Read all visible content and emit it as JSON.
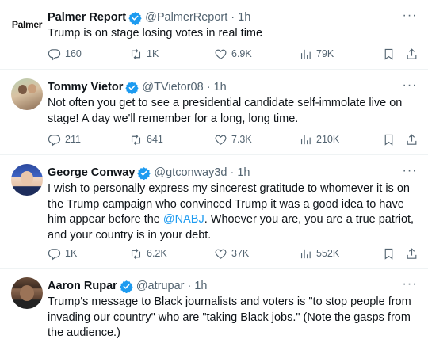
{
  "tweets": [
    {
      "name": "Palmer Report",
      "handle": "@PalmerReport",
      "sep": "·",
      "time": "1h",
      "avatar_text": "Palmer",
      "text_parts": [
        "Trump is on stage losing votes in real time"
      ],
      "mention": "",
      "text_after": "",
      "stats": {
        "replies": "160",
        "reposts": "1K",
        "likes": "6.9K",
        "views": "79K"
      }
    },
    {
      "name": "Tommy Vietor",
      "handle": "@TVietor08",
      "sep": "·",
      "time": "1h",
      "text_parts": [
        "Not often you get to see a presidential candidate self-immolate live on stage! A day we'll remember for a long, long time."
      ],
      "mention": "",
      "text_after": "",
      "stats": {
        "replies": "211",
        "reposts": "641",
        "likes": "7.3K",
        "views": "210K"
      }
    },
    {
      "name": "George Conway",
      "handle": "@gtconway3d",
      "sep": "·",
      "time": "1h",
      "text_parts": [
        "I wish to personally express my sincerest gratitude to whomever it is on the Trump campaign who convinced Trump it was a good idea to have him appear before the "
      ],
      "mention": "@NABJ",
      "text_after": ".  Whoever you are, you are a true patriot, and your country is in your debt.",
      "stats": {
        "replies": "1K",
        "reposts": "6.2K",
        "likes": "37K",
        "views": "552K"
      }
    },
    {
      "name": "Aaron Rupar",
      "handle": "@atrupar",
      "sep": "·",
      "time": "1h",
      "text_parts": [
        "Trump's message to Black journalists and voters is \"to stop people from invading our country\" who are \"taking Black jobs.\" (Note the gasps from the audience.)"
      ],
      "mention": "",
      "text_after": ""
    }
  ],
  "colors": {
    "accent": "#1d9bf0",
    "muted": "#536471",
    "text": "#0f1419",
    "divider": "#eff3f4"
  },
  "icons": [
    "verified-badge-icon",
    "more-icon",
    "reply-icon",
    "repost-icon",
    "like-icon",
    "views-icon",
    "bookmark-icon",
    "share-icon"
  ]
}
